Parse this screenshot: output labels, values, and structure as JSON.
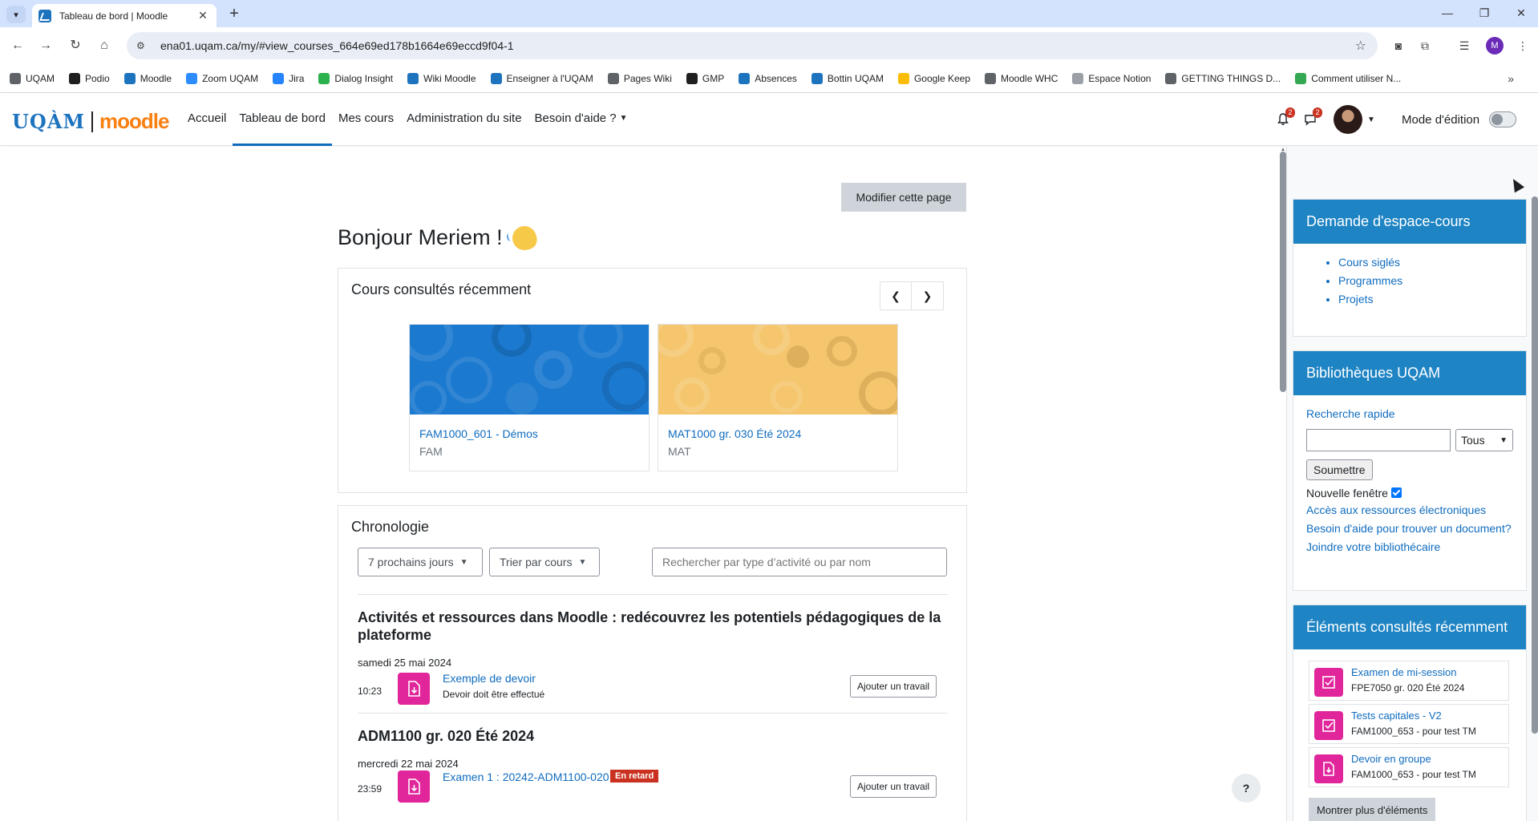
{
  "browser": {
    "tab_title": "Tableau de bord | Moodle",
    "url": "ena01.uqam.ca/my/#view_courses_664e69ed178b1664e69eccd9f04-1",
    "profile_initial": "M",
    "bookmarks": [
      {
        "label": "UQAM",
        "color": "#5f6368"
      },
      {
        "label": "Podio",
        "color": "#1f1f1f"
      },
      {
        "label": "Moodle",
        "color": "#1e73be"
      },
      {
        "label": "Zoom UQAM",
        "color": "#2d8cff"
      },
      {
        "label": "Jira",
        "color": "#2684ff"
      },
      {
        "label": "Dialog Insight",
        "color": "#2bb24c"
      },
      {
        "label": "Wiki Moodle",
        "color": "#1e73be"
      },
      {
        "label": "Enseigner à l'UQAM",
        "color": "#1e73be"
      },
      {
        "label": "Pages Wiki",
        "color": "#5f6368"
      },
      {
        "label": "GMP",
        "color": "#1f1f1f"
      },
      {
        "label": "Absences",
        "color": "#1e73be"
      },
      {
        "label": "Bottin UQAM",
        "color": "#1e73be"
      },
      {
        "label": "Google Keep",
        "color": "#fbbc04"
      },
      {
        "label": "Moodle WHC",
        "color": "#5f6368"
      },
      {
        "label": "Espace Notion",
        "color": "#9aa0a6"
      },
      {
        "label": "GETTING THINGS D...",
        "color": "#5f6368"
      },
      {
        "label": "Comment utiliser N...",
        "color": "#34a853"
      }
    ]
  },
  "navbar": {
    "logo_uqam": "UQÀM",
    "logo_moodle": "moodle",
    "items": [
      {
        "label": "Accueil",
        "active": false
      },
      {
        "label": "Tableau de bord",
        "active": true
      },
      {
        "label": "Mes cours",
        "active": false
      },
      {
        "label": "Administration du site",
        "active": false
      },
      {
        "label": "Besoin d'aide ?",
        "active": false,
        "dropdown": true
      }
    ],
    "notifications_count": "2",
    "messages_count": "2",
    "edit_mode_label": "Mode d'édition"
  },
  "main": {
    "modify_page_label": "Modifier cette page",
    "greeting": "Bonjour Meriem !",
    "recent_courses": {
      "title": "Cours consultés récemment",
      "courses": [
        {
          "name": "FAM1000_601 - Démos",
          "category": "FAM",
          "theme": "blue"
        },
        {
          "name": "MAT1000 gr. 030 Été 2024",
          "category": "MAT",
          "theme": "yellow"
        }
      ]
    },
    "timeline": {
      "title": "Chronologie",
      "filter_label": "7 prochains jours",
      "sort_label": "Trier par cours",
      "search_placeholder": "Rechercher par type d’activité ou par nom",
      "groups": [
        {
          "course": "Activités et ressources dans Moodle : redécouvrez les potentiels pédagogiques de la plateforme",
          "date": "samedi 25 mai 2024",
          "event": {
            "time": "10:23",
            "name": "Exemple de devoir",
            "status": "Devoir doit être effectué",
            "action": "Ajouter un travail"
          }
        },
        {
          "course": "ADM1100 gr. 020 Été 2024",
          "date": "mercredi 22 mai 2024",
          "event": {
            "time": "23:59",
            "name": "Examen 1 : 20242-ADM1100-020",
            "overdue": "En retard",
            "action": "Ajouter un travail"
          }
        }
      ]
    },
    "help_label": "?"
  },
  "drawer": {
    "course_request": {
      "title": "Demande d'espace-cours",
      "links": [
        "Cours siglés",
        "Programmes",
        "Projets"
      ]
    },
    "libraries": {
      "title": "Bibliothèques UQAM",
      "quick_search": "Recherche rapide",
      "scope_value": "Tous",
      "submit_label": "Soumettre",
      "new_window_label": "Nouvelle fenêtre",
      "links": [
        "Accès aux ressources électroniques",
        "Besoin d'aide pour trouver un document?",
        "Joindre votre bibliothécaire"
      ]
    },
    "recent_items": {
      "title": "Éléments consultés récemment",
      "items": [
        {
          "name": "Examen de mi-session",
          "course": "FPE7050 gr. 020 Été 2024",
          "icon": "quiz-icon"
        },
        {
          "name": "Tests capitales - V2",
          "course": "FAM1000_653 - pour test TM",
          "icon": "quiz-icon"
        },
        {
          "name": "Devoir en groupe",
          "course": "FAM1000_653 - pour test TM",
          "icon": "assignment-icon"
        }
      ],
      "more_label": "Montrer plus d'éléments"
    }
  },
  "colors": {
    "brand_blue": "#0f6cbf",
    "block_header": "#1e84c4",
    "activity_pink": "#e1259b",
    "overdue_red": "#ca3120",
    "moodle_orange": "#f98012"
  }
}
